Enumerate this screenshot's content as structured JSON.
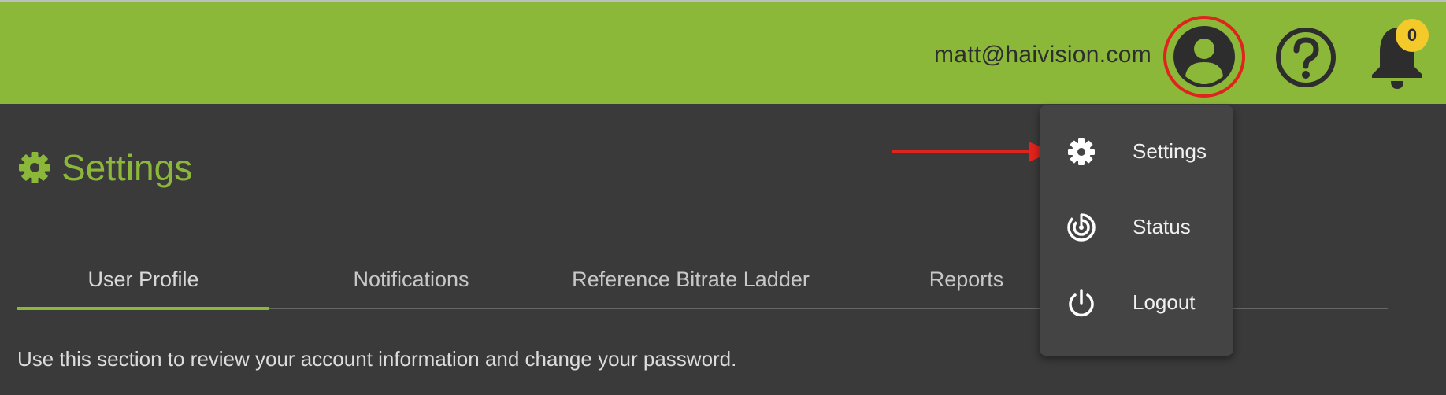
{
  "header": {
    "user_email": "matt@haivision.com",
    "avatar_icon": "account-circle-icon",
    "help_icon": "help-circle-icon",
    "bell_icon": "bell-icon",
    "notification_count": "0",
    "bar_color": "#8cb83a"
  },
  "page": {
    "title": "Settings",
    "title_icon": "gear-icon",
    "accent_color": "#8cb83a"
  },
  "tabs": [
    {
      "label": "User Profile",
      "active": true
    },
    {
      "label": "Notifications",
      "active": false
    },
    {
      "label": "Reference Bitrate Ladder",
      "active": false
    },
    {
      "label": "Reports",
      "active": false
    }
  ],
  "description": "Use this section to review your account information and change your password.",
  "user_menu": {
    "items": [
      {
        "label": "Settings",
        "icon": "gear-icon"
      },
      {
        "label": "Status",
        "icon": "status-radar-icon"
      },
      {
        "label": "Logout",
        "icon": "power-icon"
      }
    ]
  },
  "annotations": {
    "highlight_color": "#e0231c"
  }
}
